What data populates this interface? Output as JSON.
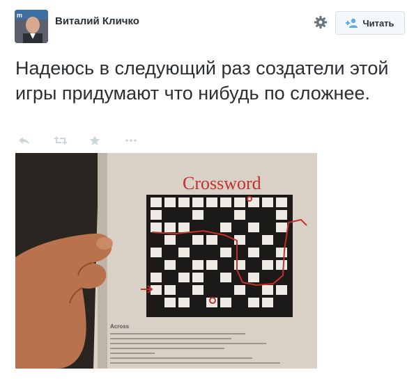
{
  "author": {
    "name": "Виталий Кличко",
    "avatar_icon": "person-avatar"
  },
  "header": {
    "settings_icon": "gear-icon",
    "follow_button_label": "Читать",
    "follow_icon": "add-user-icon"
  },
  "tweet": {
    "text": "Надеюсь в следующий раз создатели этой игры придумают что нибудь по сложнее."
  },
  "actions": [
    {
      "name": "reply",
      "icon": "reply-icon"
    },
    {
      "name": "retweet",
      "icon": "retweet-icon"
    },
    {
      "name": "favorite",
      "icon": "star-icon"
    },
    {
      "name": "more",
      "icon": "more-icon"
    }
  ],
  "photo": {
    "title": "Crossword",
    "clues_heading": "Across"
  },
  "colors": {
    "text": "#292f33",
    "icon": "#ccd6dd",
    "accent": "#55acee",
    "crossword_title": "#c4302b"
  }
}
